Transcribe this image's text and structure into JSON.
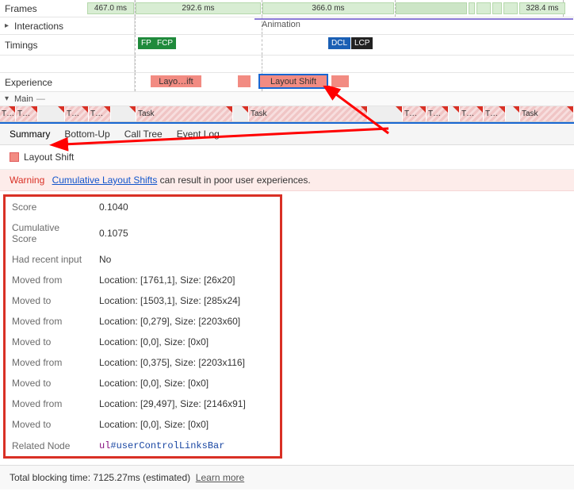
{
  "tracks": {
    "frames": {
      "label": "Frames",
      "blocks": [
        "467.0 ms",
        "292.6 ms",
        "366.0 ms",
        "328.4 ms"
      ]
    },
    "interactions": {
      "label": "Interactions",
      "animation_label": "Animation"
    },
    "timings": {
      "label": "Timings",
      "badges": {
        "fp": "FP",
        "fcp": "FCP",
        "dcl": "DCL",
        "lcp": "LCP"
      }
    },
    "experience": {
      "label": "Experience",
      "events": {
        "first": "Layo…ift",
        "second": "Layout Shift"
      }
    },
    "main": {
      "label": "Main"
    }
  },
  "tasks": {
    "short": "T…",
    "task": "Task"
  },
  "tabs": {
    "summary": "Summary",
    "bottom_up": "Bottom-Up",
    "call_tree": "Call Tree",
    "event_log": "Event Log"
  },
  "summary": {
    "title": "Layout Shift",
    "warning": {
      "label": "Warning",
      "link_text": "Cumulative Layout Shifts",
      "rest": " can result in poor user experiences."
    },
    "rows": [
      {
        "k": "Score",
        "v": "0.1040"
      },
      {
        "k": "Cumulative Score",
        "v": "0.1075"
      },
      {
        "k": "Had recent input",
        "v": "No"
      },
      {
        "k": "Moved from",
        "v": "Location: [1761,1], Size: [26x20]"
      },
      {
        "k": "Moved to",
        "v": "Location: [1503,1], Size: [285x24]"
      },
      {
        "k": "Moved from",
        "v": "Location: [0,279], Size: [2203x60]"
      },
      {
        "k": "Moved to",
        "v": "Location: [0,0], Size: [0x0]"
      },
      {
        "k": "Moved from",
        "v": "Location: [0,375], Size: [2203x116]"
      },
      {
        "k": "Moved to",
        "v": "Location: [0,0], Size: [0x0]"
      },
      {
        "k": "Moved from",
        "v": "Location: [29,497], Size: [2146x91]"
      },
      {
        "k": "Moved to",
        "v": "Location: [0,0], Size: [0x0]"
      }
    ],
    "related": {
      "label": "Related Node",
      "tag": "ul",
      "id": "#userControlLinksBar"
    }
  },
  "footer": {
    "tbt_prefix": "Total blocking time: ",
    "tbt_value": "7125.27ms (estimated)",
    "learn_more": "Learn more"
  }
}
